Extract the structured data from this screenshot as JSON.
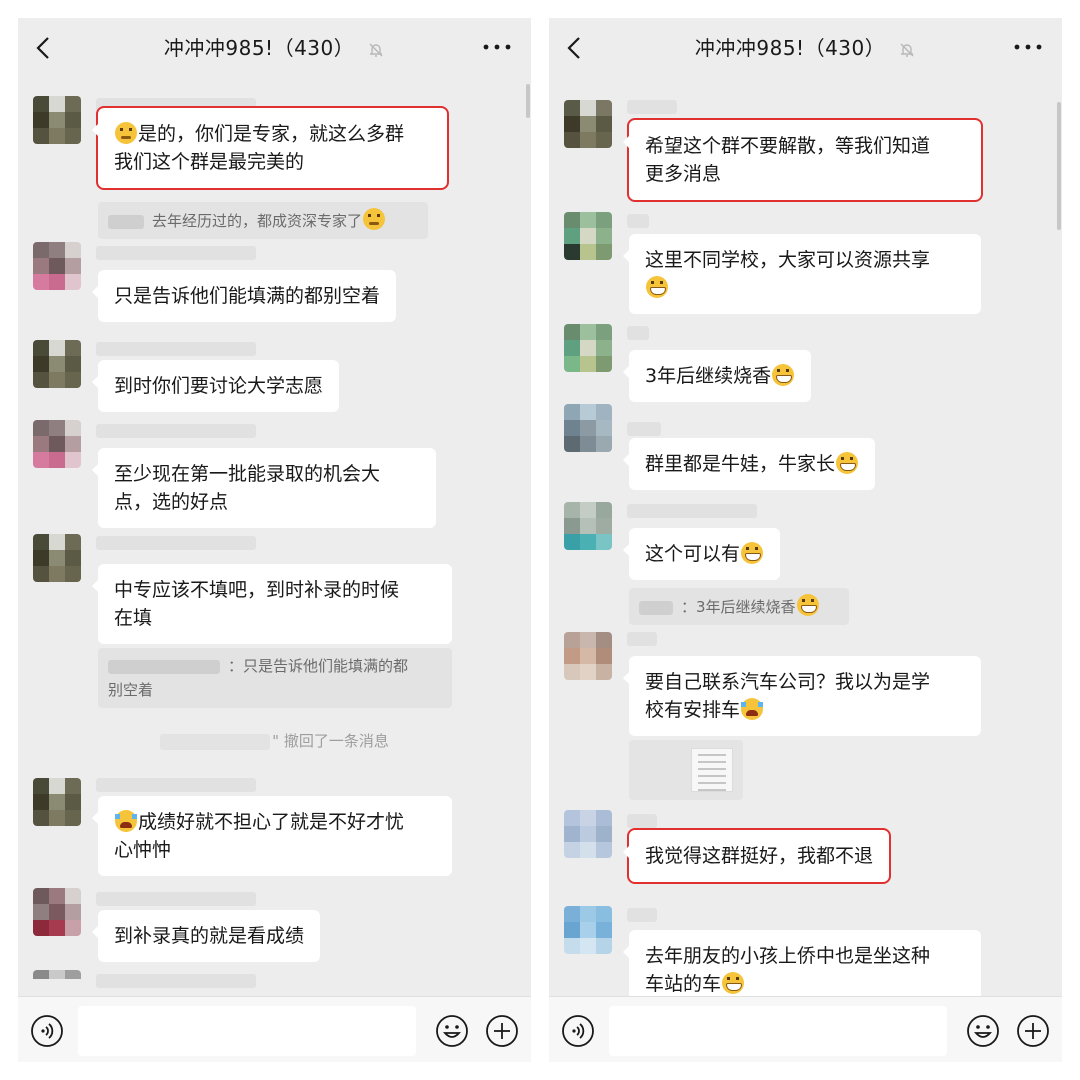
{
  "colors": {
    "panel_bg": "#ededed",
    "bubble_bg": "#ffffff",
    "highlight": "#e03030",
    "system_text": "#9e9e9e"
  },
  "icons": [
    "back-arrow-icon",
    "mute-bell-icon",
    "more-dots-icon",
    "voice-icon",
    "emoji-icon",
    "plus-icon",
    "grin-emoji-icon",
    "thinking-emoji-icon",
    "crying-laugh-emoji-icon"
  ],
  "left": {
    "header": {
      "title": "冲冲冲985!（430）"
    },
    "messages": [
      {
        "text": "是的，你们是专家，就这么多群我们这个群是最完美的",
        "line1": "是的，你们是专家，就这么多群",
        "line2": "我们这个群是最完美的",
        "lead_emoji": "thinking",
        "highlighted": true
      },
      {
        "quote": "去年经历过的，都成资深专家了",
        "quote_emoji": "thinking"
      },
      {
        "text": "只是告诉他们能填满的都别空着"
      },
      {
        "text": "到时你们要讨论大学志愿"
      },
      {
        "line1": "至少现在第一批能录取的机会大",
        "line2": "点，选的好点"
      },
      {
        "line1": "中专应该不填吧，到时补录的时候",
        "line2": "在填"
      },
      {
        "quote_line1": "：只是告诉他们能填满的都",
        "quote_line2": "别空着"
      },
      {
        "system": "\" 撤回了一条消息"
      },
      {
        "line1": "成绩好就不担心了就是不好才忧",
        "line2": "心忡忡",
        "lead_emoji": "crying-laugh"
      },
      {
        "text": "到补录真的就是看成绩"
      }
    ]
  },
  "right": {
    "header": {
      "title": "冲冲冲985!（430）"
    },
    "messages": [
      {
        "line1": "希望这个群不要解散，等我们知道",
        "line2": "更多消息",
        "highlighted": true
      },
      {
        "line1": "这里不同学校，大家可以资源共享",
        "trail_emoji": "grin"
      },
      {
        "text": "3年后继续烧香",
        "trail_emoji": "grin"
      },
      {
        "text": "群里都是牛娃，牛家长",
        "trail_emoji": "grin"
      },
      {
        "text": "这个可以有",
        "trail_emoji": "grin"
      },
      {
        "quote": "：3年后继续烧香",
        "quote_emoji": "grin"
      },
      {
        "line1": "要自己联系汽车公司？我以为是学",
        "line2": "校有安排车",
        "trail_emoji": "crying-laugh"
      },
      {
        "image": "document-photo"
      },
      {
        "text": "我觉得这群挺好，我都不退",
        "highlighted": true
      },
      {
        "line1": "去年朋友的小孩上侨中也是坐这种",
        "line2": "车站的车",
        "trail_emoji": "grin"
      }
    ]
  }
}
